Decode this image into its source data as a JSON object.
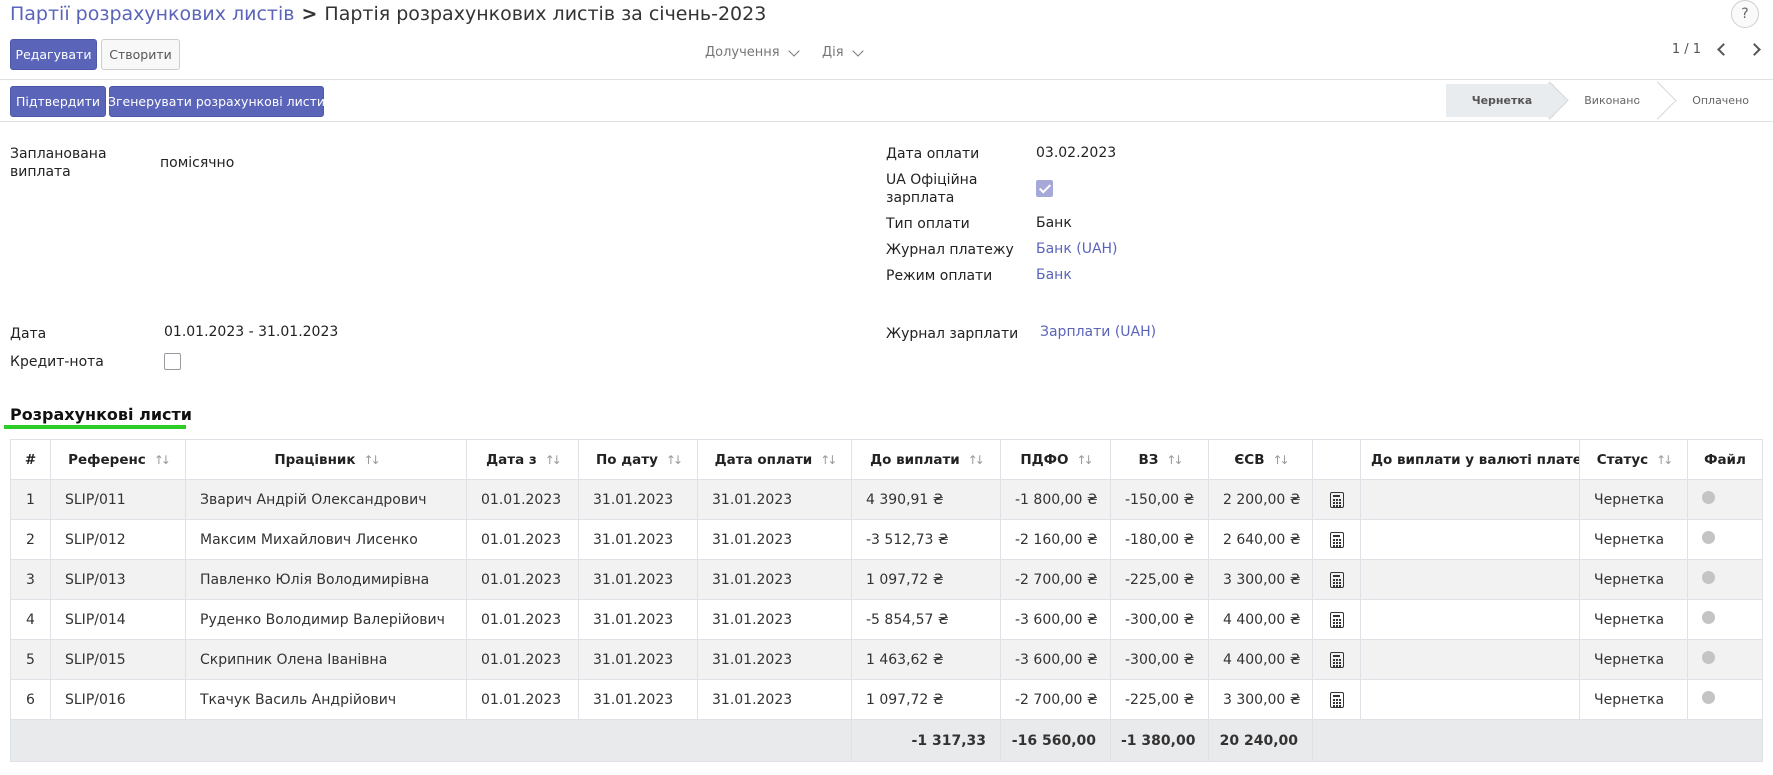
{
  "breadcrumb": {
    "parent": "Партії розрахункових листів",
    "separator": ">",
    "current": "Партія розрахункових листів за січень-2023"
  },
  "help_label": "?",
  "toolbar": {
    "edit_label": "Редагувати",
    "create_label": "Створити",
    "print_label": "Долучення",
    "action_label": "Дія",
    "pager": "1 / 1"
  },
  "status_bar": {
    "confirm_label": "Підтвердити",
    "generate_label": "Згенерувати розрахункові листи",
    "stages": [
      {
        "label": "Чернетка",
        "active": true
      },
      {
        "label": "Виконано",
        "active": false
      },
      {
        "label": "Оплачено",
        "active": false
      }
    ]
  },
  "form": {
    "scheduled_pay_label": "Запланована виплата",
    "scheduled_pay_value": "помісячно",
    "payment_date_label": "Дата оплати",
    "payment_date_value": "03.02.2023",
    "official_salary_label": "UA Офіційна зарплата",
    "official_salary_checked": true,
    "payment_type_label": "Тип оплати",
    "payment_type_value": "Банк",
    "payment_journal_label": "Журнал платежу",
    "payment_journal_value": "Банк (UAH)",
    "payment_mode_label": "Режим оплати",
    "payment_mode_value": "Банк",
    "date_label": "Дата",
    "date_value": "01.01.2023 - 31.01.2023",
    "credit_note_label": "Кредит-нота",
    "credit_note_checked": false,
    "salary_journal_label": "Журнал зарплати",
    "salary_journal_value": "Зарплати (UAH)"
  },
  "section_title": "Розрахункові листи",
  "table": {
    "headers": {
      "num": "#",
      "ref": "Референс",
      "employee": "Працівник",
      "date_from": "Дата з",
      "date_to": "По дату",
      "pay_date": "Дата оплати",
      "to_pay": "До виплати",
      "pdfo": "ПДФО",
      "vz": "ВЗ",
      "esv": "ЄСВ",
      "to_pay_currency": "До виплати у валюті платежу",
      "status": "Статус",
      "file": "Файл"
    },
    "rows": [
      {
        "num": "1",
        "ref": "SLIP/011",
        "employee": "Зварич Андрій Олександрович",
        "date_from": "01.01.2023",
        "date_to": "31.01.2023",
        "pay_date": "31.01.2023",
        "to_pay": "4 390,91 ₴",
        "pdfo": "-1 800,00 ₴",
        "vz": "-150,00 ₴",
        "esv": "2 200,00 ₴",
        "to_pay_currency": "",
        "status": "Чернетка"
      },
      {
        "num": "2",
        "ref": "SLIP/012",
        "employee": "Максим Михайлович Лисенко",
        "date_from": "01.01.2023",
        "date_to": "31.01.2023",
        "pay_date": "31.01.2023",
        "to_pay": "-3 512,73 ₴",
        "pdfo": "-2 160,00 ₴",
        "vz": "-180,00 ₴",
        "esv": "2 640,00 ₴",
        "to_pay_currency": "",
        "status": "Чернетка"
      },
      {
        "num": "3",
        "ref": "SLIP/013",
        "employee": "Павленко Юлія Володимирівна",
        "date_from": "01.01.2023",
        "date_to": "31.01.2023",
        "pay_date": "31.01.2023",
        "to_pay": "1 097,72 ₴",
        "pdfo": "-2 700,00 ₴",
        "vz": "-225,00 ₴",
        "esv": "3 300,00 ₴",
        "to_pay_currency": "",
        "status": "Чернетка"
      },
      {
        "num": "4",
        "ref": "SLIP/014",
        "employee": "Руденко Володимир Валерійович",
        "date_from": "01.01.2023",
        "date_to": "31.01.2023",
        "pay_date": "31.01.2023",
        "to_pay": "-5 854,57 ₴",
        "pdfo": "-3 600,00 ₴",
        "vz": "-300,00 ₴",
        "esv": "4 400,00 ₴",
        "to_pay_currency": "",
        "status": "Чернетка"
      },
      {
        "num": "5",
        "ref": "SLIP/015",
        "employee": "Скрипник Олена Іванівна",
        "date_from": "01.01.2023",
        "date_to": "31.01.2023",
        "pay_date": "31.01.2023",
        "to_pay": "1 463,62 ₴",
        "pdfo": "-3 600,00 ₴",
        "vz": "-300,00 ₴",
        "esv": "4 400,00 ₴",
        "to_pay_currency": "",
        "status": "Чернетка"
      },
      {
        "num": "6",
        "ref": "SLIP/016",
        "employee": "Ткачук Василь Андрійович",
        "date_from": "01.01.2023",
        "date_to": "31.01.2023",
        "pay_date": "31.01.2023",
        "to_pay": "1 097,72 ₴",
        "pdfo": "-2 700,00 ₴",
        "vz": "-225,00 ₴",
        "esv": "3 300,00 ₴",
        "to_pay_currency": "",
        "status": "Чернетка"
      }
    ],
    "totals": {
      "to_pay": "-1 317,33",
      "pdfo": "-16 560,00",
      "vz": "-1 380,00",
      "esv": "20 240,00"
    },
    "row_icon": "calculator-icon",
    "file_icon": "status-dot-icon"
  },
  "colors": {
    "primary": "#5a64b9",
    "section_underline": "#2ecc27",
    "stage_active": "#e9ecef"
  }
}
